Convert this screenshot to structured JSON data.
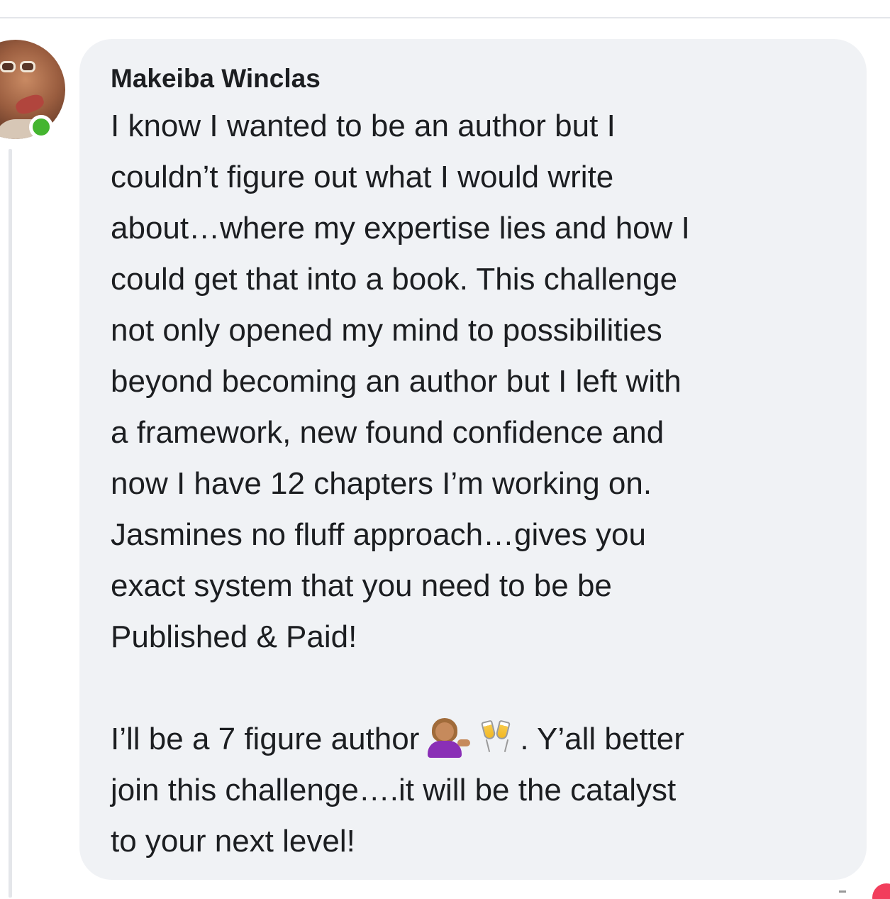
{
  "comment": {
    "author": "Makeiba Winclas",
    "avatar_icon": "profile-photo",
    "presence": "online",
    "presence_color": "#44b52f",
    "bubble_color": "#f0f2f5",
    "lines": [
      "I know I wanted to be an author but I",
      "couldn’t figure out what I would write",
      "about…where my expertise lies and how I",
      "could get that into a book. This challenge",
      "not only opened my mind to possibilities",
      "beyond becoming an author but I left with",
      "a framework, new found confidence and",
      "now I have 12 chapters I’m working on.",
      "Jasmines no fluff approach…gives you",
      "exact system that you need to be be",
      "Published & Paid!"
    ],
    "closing": {
      "line1_before": "I’ll be a 7 figure author",
      "emoji1": "woman-tipping-hand-emoji",
      "emoji2": "clinking-glasses-emoji",
      "line1_after": ". Y’all better",
      "line2": "join this challenge….it will be the catalyst",
      "line3": "to your next level!"
    }
  },
  "corner_reaction_color": "#f23e5c"
}
